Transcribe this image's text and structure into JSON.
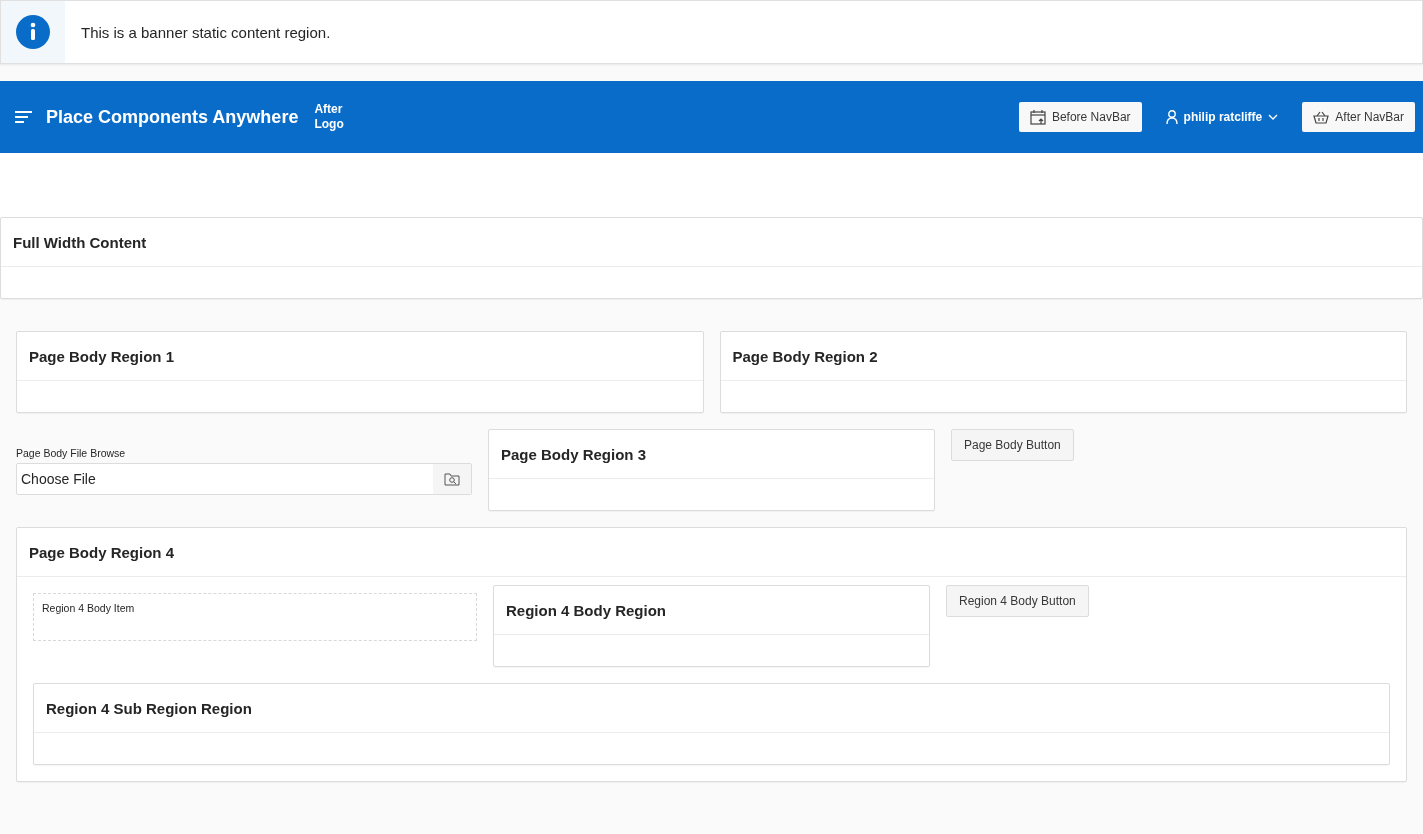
{
  "banner": {
    "text": "This is a banner static content region."
  },
  "header": {
    "title": "Place Components Anywhere",
    "after_logo": "After Logo",
    "before_navbar_button": "Before NavBar",
    "user_menu": "philip ratcliffe",
    "after_navbar_button": "After NavBar"
  },
  "full_width_region": {
    "title": "Full Width Content"
  },
  "page_body": {
    "regions": [
      {
        "title": "Page Body Region 1"
      },
      {
        "title": "Page Body Region 2"
      }
    ],
    "file_browse": {
      "label": "Page Body File Browse",
      "value": "Choose File"
    },
    "region_3": {
      "title": "Page Body Region 3"
    },
    "button": "Page Body Button",
    "region_4": {
      "title": "Page Body Region 4",
      "body_item_label": "Region 4 Body Item",
      "body_region_title": "Region 4 Body Region",
      "button": "Region 4 Body Button",
      "sub_region_title": "Region 4 Sub Region Region"
    }
  }
}
